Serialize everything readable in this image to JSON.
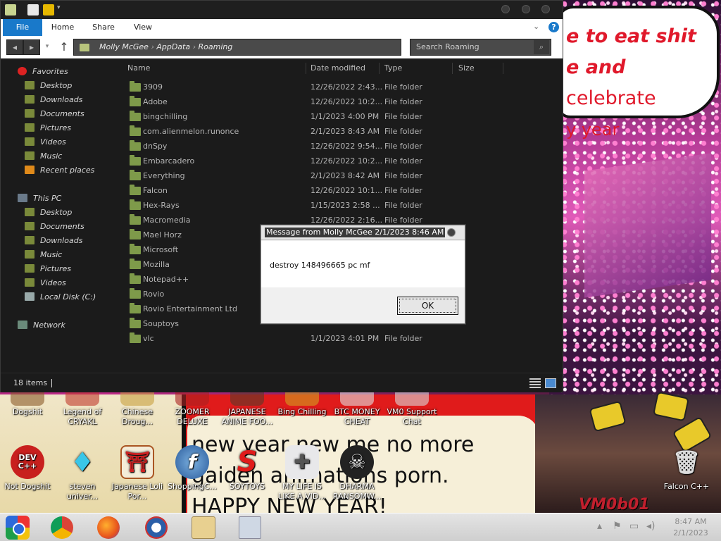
{
  "wallpaper": {
    "bubble_line1": "e to eat shit",
    "bubble_line2_bold": "e and",
    "bubble_line2_plain": "celebrate",
    "bubble_line3": "y year",
    "bottom_text_line1": "new year new me no more",
    "bottom_text_line2": "gaiden animations porn.",
    "bottom_text_line3": "HAPPY NEW YEAR!",
    "corner_tag": "VM0b01"
  },
  "desktop_icons_row1": [
    {
      "label": "Dogshit"
    },
    {
      "label": "Legend of CRYAKL"
    },
    {
      "label": "Chinese Droug..."
    },
    {
      "label": "ZOOMER DELUXE"
    },
    {
      "label": "JAPANESE ANIME FOO..."
    },
    {
      "label": "Bing Chilling"
    },
    {
      "label": "BTC MONEY CHEAT"
    },
    {
      "label": "VM0 Support Chat"
    }
  ],
  "desktop_icons_row2": [
    {
      "label": "Not Dogshit",
      "icon": "dev-cpp-icon"
    },
    {
      "label": "steven univer...",
      "icon": "diamond-icon"
    },
    {
      "label": "Japanese Loli Por...",
      "icon": "torii-icon"
    },
    {
      "label": "ShoppingC...",
      "icon": "flash-icon"
    },
    {
      "label": "SOYTOYS",
      "icon": "s-logo-icon"
    },
    {
      "label": "MY LIFE IS LIKE A VID...",
      "icon": "gamepad-icon"
    },
    {
      "label": "DHARMA RANSOMW...",
      "icon": "skull-icon"
    },
    {
      "label": "Falcon C++",
      "icon": "recycle-bin-icon"
    }
  ],
  "dev_icon_text": "DEV C++",
  "explorer": {
    "ribbon_tabs": [
      "File",
      "Home",
      "Share",
      "View"
    ],
    "help": "?",
    "breadcrumb": [
      "Molly McGee",
      "AppData",
      "Roaming"
    ],
    "search_placeholder": "Search Roaming",
    "favorites_header": "Favorites",
    "favorites": [
      "Desktop",
      "Downloads",
      "Documents",
      "Pictures",
      "Videos",
      "Music",
      "Recent places"
    ],
    "thispc_header": "This PC",
    "thispc": [
      "Desktop",
      "Documents",
      "Downloads",
      "Music",
      "Pictures",
      "Videos",
      "Local Disk (C:)"
    ],
    "network": "Network",
    "columns": {
      "name": "Name",
      "date": "Date modified",
      "type": "Type",
      "size": "Size"
    },
    "files": [
      {
        "name": "3909",
        "date": "12/26/2022 2:43...",
        "type": "File folder"
      },
      {
        "name": "Adobe",
        "date": "12/26/2022 10:2...",
        "type": "File folder"
      },
      {
        "name": "bingchilling",
        "date": "1/1/2023 4:00 PM",
        "type": "File folder"
      },
      {
        "name": "com.alienmelon.runonce",
        "date": "2/1/2023 8:43 AM",
        "type": "File folder"
      },
      {
        "name": "dnSpy",
        "date": "12/26/2022 9:54...",
        "type": "File folder"
      },
      {
        "name": "Embarcadero",
        "date": "12/26/2022 10:2...",
        "type": "File folder"
      },
      {
        "name": "Everything",
        "date": "2/1/2023 8:42 AM",
        "type": "File folder"
      },
      {
        "name": "Falcon",
        "date": "12/26/2022 10:1...",
        "type": "File folder"
      },
      {
        "name": "Hex-Rays",
        "date": "1/15/2023 2:58 ...",
        "type": "File folder"
      },
      {
        "name": "Macromedia",
        "date": "12/26/2022 2:16...",
        "type": "File folder"
      },
      {
        "name": "Mael Horz",
        "date": "",
        "type": ""
      },
      {
        "name": "Microsoft",
        "date": "",
        "type": ""
      },
      {
        "name": "Mozilla",
        "date": "",
        "type": ""
      },
      {
        "name": "Notepad++",
        "date": "",
        "type": ""
      },
      {
        "name": "Rovio",
        "date": "",
        "type": ""
      },
      {
        "name": "Rovio Entertainment Ltd",
        "date": "",
        "type": ""
      },
      {
        "name": "Souptoys",
        "date": "",
        "type": ""
      },
      {
        "name": "vlc",
        "date": "1/1/2023 4:01 PM",
        "type": "File folder"
      }
    ],
    "item_count": "18 items"
  },
  "dialog": {
    "title": "Message from Molly McGee 2/1/2023 8:46 AM",
    "message": "destroy 148496665 pc mf",
    "ok_label": "OK"
  },
  "taskbar": {
    "time": "8:47 AM",
    "date": "2/1/2023"
  },
  "colors": {
    "ribbon_accent": "#1979ca",
    "folder": "#7e9a4a",
    "explorer_bg": "#1b1b1b"
  }
}
